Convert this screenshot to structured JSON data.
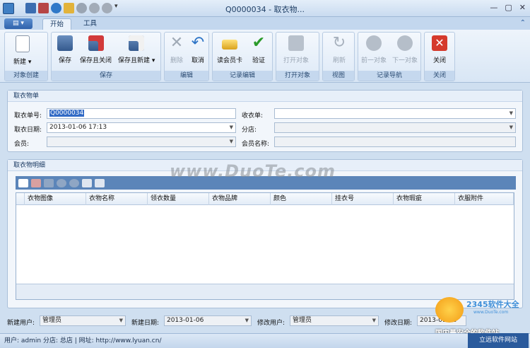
{
  "window": {
    "title": "Q0000034 - 取衣物..."
  },
  "ribbon_tabs": [
    {
      "label": "开始"
    },
    {
      "label": "工具"
    }
  ],
  "ribbon": {
    "groups": [
      {
        "label": "对象创建",
        "buttons": [
          {
            "label": "新建"
          }
        ]
      },
      {
        "label": "保存",
        "buttons": [
          {
            "label": "保存"
          },
          {
            "label": "保存且关闭"
          },
          {
            "label": "保存且新建"
          }
        ]
      },
      {
        "label": "编辑",
        "buttons": [
          {
            "label": "删除"
          },
          {
            "label": "取消"
          }
        ]
      },
      {
        "label": "记录编辑",
        "buttons": [
          {
            "label": "读会员卡"
          },
          {
            "label": "验证"
          }
        ]
      },
      {
        "label": "打开对象",
        "buttons": [
          {
            "label": "打开对象"
          }
        ]
      },
      {
        "label": "视图",
        "buttons": [
          {
            "label": "刷新"
          }
        ]
      },
      {
        "label": "记录导航",
        "buttons": [
          {
            "label": "前一对象"
          },
          {
            "label": "下一对象"
          }
        ]
      },
      {
        "label": "关闭",
        "buttons": [
          {
            "label": "关闭"
          }
        ]
      }
    ]
  },
  "form": {
    "header": "取衣物单",
    "order_no_label": "取衣单号:",
    "order_no_value": "Q0000034",
    "pickup_date_label": "取衣日期:",
    "pickup_date_value": "2013-01-06 17:13",
    "member_label": "会员:",
    "member_value": "",
    "receipt_label": "收衣单:",
    "receipt_value": "",
    "branch_label": "分店:",
    "branch_value": "",
    "member_name_label": "会员名称:",
    "member_name_value": ""
  },
  "details": {
    "header": "取衣物明细",
    "columns": [
      "衣物图像",
      "衣物名称",
      "领衣数量",
      "衣物品牌",
      "颜色",
      "挂衣号",
      "衣物瑕疵",
      "衣服附件"
    ]
  },
  "footer": {
    "new_user_label": "新建用户:",
    "new_user_value": "管理员",
    "new_date_label": "新建日期:",
    "new_date_value": "2013-01-06",
    "mod_user_label": "修改用户:",
    "mod_user_value": "管理员",
    "mod_date_label": "修改日期:",
    "mod_date_value": "2013-01-06"
  },
  "status": {
    "text": "用户: admin  分店: 总店  |  网址: http://www.lyuan.cn/",
    "link": "立远软件网站"
  },
  "watermark": {
    "text": "www.DuoTe.com",
    "brand": "2345软件大全",
    "brand_url": "www.DuoTe.com",
    "slogan": "国内最安全的软件站"
  }
}
